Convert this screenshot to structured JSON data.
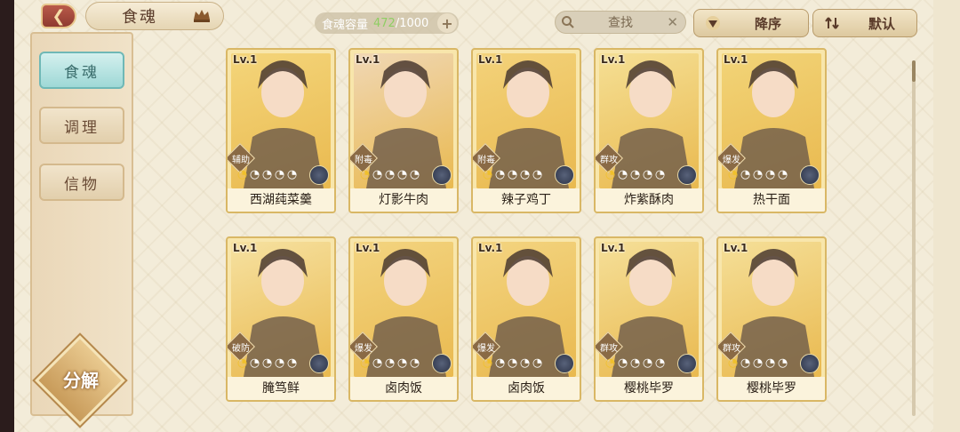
{
  "header": {
    "title": "食魂",
    "capacity_label": "食魂容量",
    "capacity_current": "472",
    "capacity_max": "/1000",
    "search_placeholder": "查找",
    "sort_order_label": "降序",
    "sort_default_label": "默认"
  },
  "sidebar": {
    "tabs": [
      {
        "label": "食魂",
        "active": true
      },
      {
        "label": "调理",
        "active": false
      },
      {
        "label": "信物",
        "active": false
      }
    ],
    "decompose_label": "分解"
  },
  "cards": [
    {
      "level": "Lv.1",
      "role": "辅助",
      "name": "西湖莼菜羹",
      "stars": 1,
      "element_icon": "flower-icon",
      "art": "green-hat-character",
      "bg": "#f4d57a"
    },
    {
      "level": "Lv.1",
      "role": "附毒",
      "name": "灯影牛肉",
      "stars": 1,
      "element_icon": "star-icon",
      "art": "pink-hair-character",
      "bg": "#f0d7b4"
    },
    {
      "level": "Lv.1",
      "role": "附毒",
      "name": "辣子鸡丁",
      "stars": 1,
      "element_icon": "star-icon",
      "art": "red-hair-character",
      "bg": "#f3d27a"
    },
    {
      "level": "Lv.1",
      "role": "群攻",
      "name": "炸紫酥肉",
      "stars": 1,
      "element_icon": "star-icon",
      "art": "dark-hair-character",
      "bg": "#f5df94"
    },
    {
      "level": "Lv.1",
      "role": "爆发",
      "name": "热干面",
      "stars": 1,
      "element_icon": "star-icon",
      "art": "yellow-hoodie-character",
      "bg": "#f2d478"
    },
    {
      "level": "Lv.1",
      "role": "破防",
      "name": "腌笃鲜",
      "stars": 1,
      "element_icon": "star-icon",
      "art": "white-hair-character",
      "bg": "#f6e1a0"
    },
    {
      "level": "Lv.1",
      "role": "爆发",
      "name": "卤肉饭",
      "stars": 1,
      "element_icon": "star-icon",
      "art": "headband-character",
      "bg": "#f3d480"
    },
    {
      "level": "Lv.1",
      "role": "爆发",
      "name": "卤肉饭",
      "stars": 1,
      "element_icon": "star-icon",
      "art": "headband-character",
      "bg": "#f3d480"
    },
    {
      "level": "Lv.1",
      "role": "群攻",
      "name": "樱桃毕罗",
      "stars": 1,
      "element_icon": "star-icon",
      "art": "crown-character",
      "bg": "#f5df98"
    },
    {
      "level": "Lv.1",
      "role": "群攻",
      "name": "樱桃毕罗",
      "stars": 1,
      "element_icon": "star-icon",
      "art": "crown-character",
      "bg": "#f5df98"
    }
  ]
}
